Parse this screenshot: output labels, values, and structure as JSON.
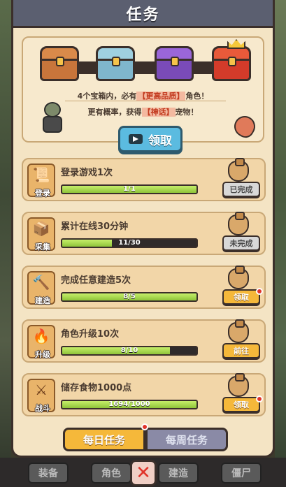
{
  "header": {
    "title": "任务"
  },
  "chest_panel": {
    "line1_pre": "4个宝箱内，必有",
    "line1_hl": "【更高品质】",
    "line1_post": "角色！",
    "line2_pre": "更有概率，获得",
    "line2_hl": "【神话】",
    "line2_post": "宠物！",
    "claim_label": "领取",
    "chests": [
      "wooden-chest-icon",
      "blue-chest-icon",
      "purple-chest-icon",
      "red-gold-chest-icon"
    ]
  },
  "tasks": [
    {
      "title": "登录游戏1次",
      "icon_label": "登录",
      "progress_text": "1/1",
      "progress": 1.0,
      "button": "已完成",
      "state": "done",
      "badge": false
    },
    {
      "title": "累计在线30分钟",
      "icon_label": "采集",
      "progress_text": "11/30",
      "progress": 0.37,
      "button": "未完成",
      "state": "done",
      "badge": false
    },
    {
      "title": "完成任意建造5次",
      "icon_label": "建造",
      "progress_text": "8/5",
      "progress": 1.0,
      "button": "领取",
      "state": "claim",
      "badge": true
    },
    {
      "title": "角色升级10次",
      "icon_label": "升级",
      "progress_text": "8/10",
      "progress": 0.8,
      "button": "前往",
      "state": "go",
      "badge": false
    },
    {
      "title": "储存食物1000点",
      "icon_label": "战斗",
      "progress_text": "1694/1000",
      "progress": 1.0,
      "button": "领取",
      "state": "claim",
      "badge": true
    }
  ],
  "tabs": {
    "daily": "每日任务",
    "weekly": "每周任务"
  },
  "bottom_nav": {
    "equip": "装备",
    "role": "角色",
    "build": "建造",
    "zombie": "僵尸"
  }
}
